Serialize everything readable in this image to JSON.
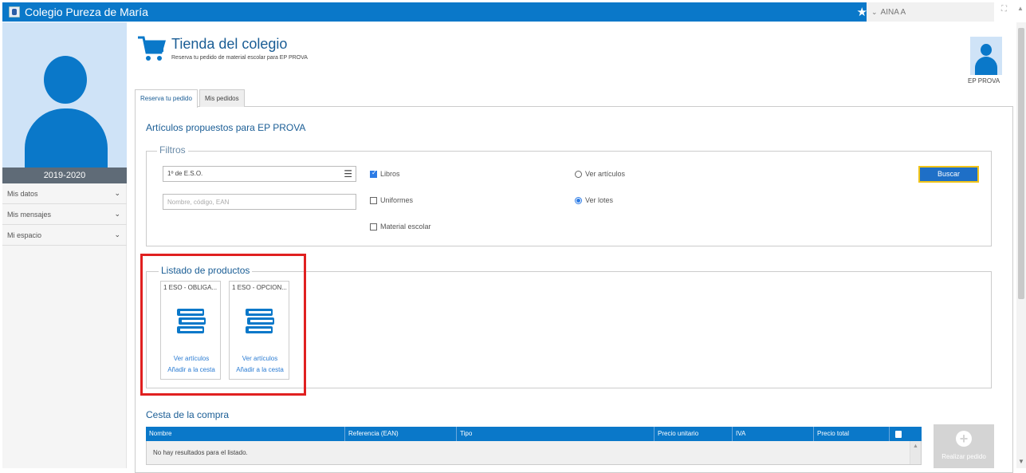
{
  "app": {
    "title": "Colegio Pureza de María",
    "user_name": "AINA A"
  },
  "sidebar": {
    "year": "2019-2020",
    "items": [
      {
        "label": "Mis datos"
      },
      {
        "label": "Mis mensajes"
      },
      {
        "label": "Mi espacio"
      }
    ]
  },
  "header": {
    "title": "Tienda del colegio",
    "subtitle": "Reserva tu pedido de material escolar para EP PROVA",
    "avatar_name": "EP PROVA"
  },
  "tabs": [
    {
      "label": "Reserva tu pedido",
      "active": true
    },
    {
      "label": "Mis pedidos",
      "active": false
    }
  ],
  "section_title": "Artículos propuestos para EP PROVA",
  "filters": {
    "legend": "Filtros",
    "course_select": "1º de E.S.O.",
    "search_placeholder": "Nombre, código, EAN",
    "checkboxes": [
      {
        "label": "Libros",
        "checked": true
      },
      {
        "label": "Uniformes",
        "checked": false
      },
      {
        "label": "Material escolar",
        "checked": false
      }
    ],
    "radios": [
      {
        "label": "Ver artículos",
        "selected": false
      },
      {
        "label": "Ver lotes",
        "selected": true
      }
    ],
    "search_button": "Buscar"
  },
  "products": {
    "legend": "Listado de productos",
    "items": [
      {
        "title": "1 ESO - OBLIGA...",
        "icon": "books-icon",
        "view_link": "Ver artículos",
        "add_link": "Añadir a la cesta"
      },
      {
        "title": "1 ESO - OPCION...",
        "icon": "books-icon",
        "view_link": "Ver artículos",
        "add_link": "Añadir a la cesta"
      }
    ]
  },
  "cart": {
    "title": "Cesta de la compra",
    "columns": [
      "Nombre",
      "Referencia (EAN)",
      "Tipo",
      "Precio unitario",
      "IVA",
      "Precio total"
    ],
    "empty_text": "No hay resultados para el listado.",
    "order_button": "Realizar pedido"
  },
  "colors": {
    "primary": "#0a78c9",
    "highlight": "#e02020",
    "button_border": "#f0c419"
  }
}
